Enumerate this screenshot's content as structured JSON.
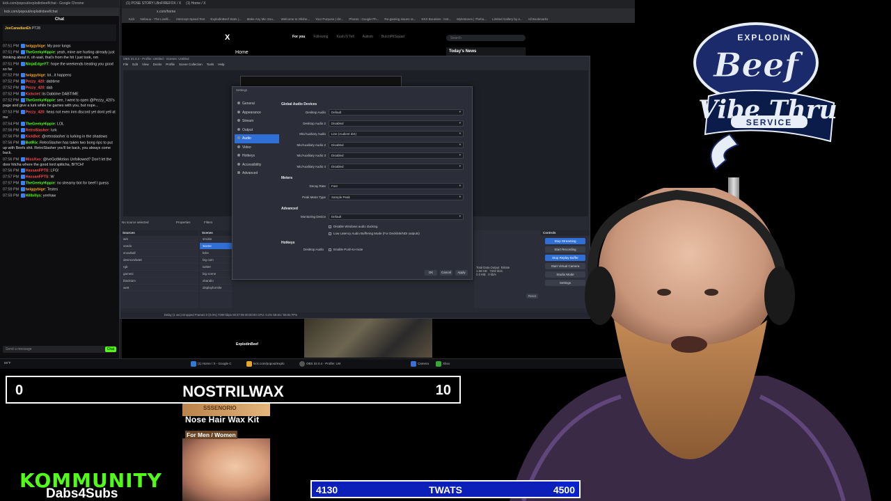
{
  "chat_window": {
    "title": "kick.com/popout/explodinbeef/chat - Google Chrome",
    "url": "kick.com/popout/explodinbeef/chat",
    "header": "Chat",
    "pinned_user": "JoeCanadianEh",
    "pinned_badge": "PT28",
    "messages": [
      {
        "time": "07:51 PM",
        "user": "twiggybige",
        "user_color": "#f5a623",
        "text": "My poor lungs"
      },
      {
        "time": "07:51 PM",
        "user": "TheGeekyHippie",
        "user_color": "#53fc18",
        "text": "yeah, mine are hurting already just thinking about it. oh wait, that's from the hit I just took, nm"
      },
      {
        "time": "07:51 PM",
        "user": "NinjaEdgeYT",
        "user_color": "#53fc18",
        "text": "hope the weekends treating you good so far"
      },
      {
        "time": "07:52 PM",
        "user": "twiggybige",
        "user_color": "#f5a623",
        "text": "lol...it happens"
      },
      {
        "time": "07:52 PM",
        "user": "Pezzy_420",
        "user_color": "#ff4d4d",
        "text": "dabtime"
      },
      {
        "time": "07:52 PM",
        "user": "Pezzy_420",
        "user_color": "#ff4d4d",
        "text": "dab"
      },
      {
        "time": "07:52 PM",
        "user": "Kickclet",
        "user_color": "#ff4d4d",
        "text": "its Dabtime DABTIME"
      },
      {
        "time": "07:52 PM",
        "user": "TheGeekyHippie",
        "user_color": "#53fc18",
        "text": "see, I went to open @Pezzy_420's page and give a lurk while he games with you, but nope..."
      },
      {
        "time": "07:53 PM",
        "user": "Pezzy_420",
        "user_color": "#ff4d4d",
        "text": "heas not even inm discord yet dont yell at me"
      },
      {
        "time": "07:54 PM",
        "user": "TheGeekyHippie",
        "user_color": "#53fc18",
        "text": "LOL"
      },
      {
        "time": "07:56 PM",
        "user": "RetroSlasher",
        "user_color": "#ff4d4d",
        "text": "lurk"
      },
      {
        "time": "07:56 PM",
        "user": "KickBot",
        "user_color": "#ff4d4d",
        "text": "@retroslasher is lurking in the shadows"
      },
      {
        "time": "07:56 PM",
        "user": "BotRix",
        "user_color": "#53fc18",
        "text": "RetroSlasher has taken two bong rips to put up with Beefs shit. RetroSlasher you'll be back, you always come back."
      },
      {
        "time": "07:56 PM",
        "user": "MissXxo",
        "user_color": "#ff4d4d",
        "text": "@IveGotMotion Unfollowed? Don't let the door hitcha where the good lord splitcha, BITCH!"
      },
      {
        "time": "07:56 PM",
        "user": "HassanFPTS",
        "user_color": "#ff4d4d",
        "text": "LFG!"
      },
      {
        "time": "07:57 PM",
        "user": "HassanFPTS",
        "user_color": "#ff4d4d",
        "text": "W"
      },
      {
        "time": "07:57 PM",
        "user": "TheGeekyHippie",
        "user_color": "#53fc18",
        "text": "no streamy bot for beef I guess"
      },
      {
        "time": "07:59 PM",
        "user": "twiggybige",
        "user_color": "#f5a623",
        "text": "Testes"
      },
      {
        "time": "07:59 PM",
        "user": "Hillbillys",
        "user_color": "#53fc18",
        "text": "yeehaw"
      }
    ],
    "input_placeholder": "Send a message",
    "send_label": "Chat"
  },
  "x_window": {
    "tabs": [
      "(1) POSE STORY LBnFIREFOX / X",
      "(1) Home / X"
    ],
    "url": "x.com/home",
    "bookmarks": [
      "Kick",
      "Nebuuu - The Livelli...",
      "Intercept Speed Test",
      "ExplodinBeef Stats |...",
      "Make Any Mic Sou...",
      "Welcome to Olishe...",
      "Your Purpose | ckt...",
      "Photos - Google Ph...",
      "Re-gaming issues ra...",
      "KKX Bounties - Inst...",
      "Mylestones | Theha...",
      "Limited Gallery by a...",
      "All Bookmarks"
    ],
    "logo": "X",
    "home_label": "Home",
    "feed_tabs": [
      "For you",
      "Following",
      "Kush N Tell",
      "Autism",
      "ButchPitSquad"
    ],
    "search_placeholder": "Search",
    "news_title": "Today's News",
    "profile_name": "ExplodinBeef"
  },
  "obs": {
    "title": "OBS 31.0.4 - Profile: Untitled - Scenes: Untitled",
    "menu": [
      "File",
      "Edit",
      "View",
      "Docks",
      "Profile",
      "Scene Collection",
      "Tools",
      "Help"
    ],
    "source_status": "No source selected",
    "properties_label": "Properties",
    "filters_label": "Filters",
    "sources_header": "Sources",
    "sources": [
      "w/e",
      "veedo",
      "snowball",
      "desmondwatt",
      "rgb",
      "gamesi",
      "blacktam",
      "wett"
    ],
    "scenes_header": "Scenes",
    "scenes": [
      "smoke",
      "Scene",
      "brbs",
      "big cam",
      "twitter",
      "big scene",
      "xbandio",
      "displayformile"
    ],
    "scene_selected": "Scene",
    "controls_header": "Controls",
    "controls": [
      "Stop Streaming",
      "Start Recording",
      "Stop Replay Buffer",
      "Start Virtual Camera",
      "Studio Mode",
      "Settings"
    ],
    "stats_labels": [
      "Total Data Output",
      "Bitrate"
    ],
    "stats_values": [
      "1.59 GB",
      "7202 kb/s",
      "0.0 MB",
      "0 kb/s"
    ],
    "reset_label": "Reset",
    "status": "Delay (1 sec)   Dropped Frames 0 (0.0%)   7298 kbps   00:37:08   00:00:00   CPU: 0.2%   59.94 / 59.94 FPS"
  },
  "settings": {
    "title": "Settings",
    "nav": [
      "General",
      "Appearance",
      "Stream",
      "Output",
      "Audio",
      "Video",
      "Hotkeys",
      "Accessibility",
      "Advanced"
    ],
    "nav_selected": "Audio",
    "global_audio_header": "Global Audio Devices",
    "devices": [
      {
        "label": "Desktop Audio",
        "value": "Default"
      },
      {
        "label": "Desktop Audio 2",
        "value": "Disabled"
      },
      {
        "label": "Mic/Auxiliary Audio",
        "value": "Line (Audient iD4)"
      },
      {
        "label": "Mic/Auxiliary Audio 2",
        "value": "Disabled"
      },
      {
        "label": "Mic/Auxiliary Audio 3",
        "value": "Disabled"
      },
      {
        "label": "Mic/Auxiliary Audio 4",
        "value": "Disabled"
      }
    ],
    "meters_header": "Meters",
    "meters": [
      {
        "label": "Decay Rate",
        "value": "Fast"
      },
      {
        "label": "Peak Meter Type",
        "value": "Sample Peak"
      }
    ],
    "advanced_header": "Advanced",
    "monitoring": {
      "label": "Monitoring Device",
      "value": "Default"
    },
    "checks": [
      "Disable Windows audio ducking",
      "Low Latency Audio Buffering Mode (For Decklink/NDI outputs)"
    ],
    "hotkeys_header": "Hotkeys",
    "hotkey_row": {
      "label": "Desktop Audio",
      "value": "Enable Push-to-mute"
    },
    "buttons": [
      "OK",
      "Cancel",
      "Apply"
    ]
  },
  "taskbar": {
    "items": [
      "(1) Home / X - Google C",
      "kick.com/popout/explo",
      "OBS 32.0.4 - Profile: Unt",
      "Camera",
      "Xbox"
    ],
    "weather": "59°F"
  },
  "logo": {
    "line1": "EXPLODIN",
    "line2": "Beef",
    "line3": "Vibe Thru",
    "line4": "SERVICE"
  },
  "scoreboard": {
    "left_score": "0",
    "title": "NOSTRILWAX",
    "right_score": "10"
  },
  "product": {
    "brand": "SSSENORIO",
    "title": "Nose Hair Wax Kit",
    "subtitle": "For Men / Women"
  },
  "kommunity": {
    "title": "KOMMUNITY",
    "subtitle": "Dabs4Subs"
  },
  "goal": {
    "current": "4130",
    "label": "TWATS",
    "target": "4500",
    "progress_fraction": 0.918
  },
  "colors": {
    "kick_green": "#53fc18",
    "obs_blue": "#2f6fd6",
    "goal_blue": "#0a22cc"
  }
}
